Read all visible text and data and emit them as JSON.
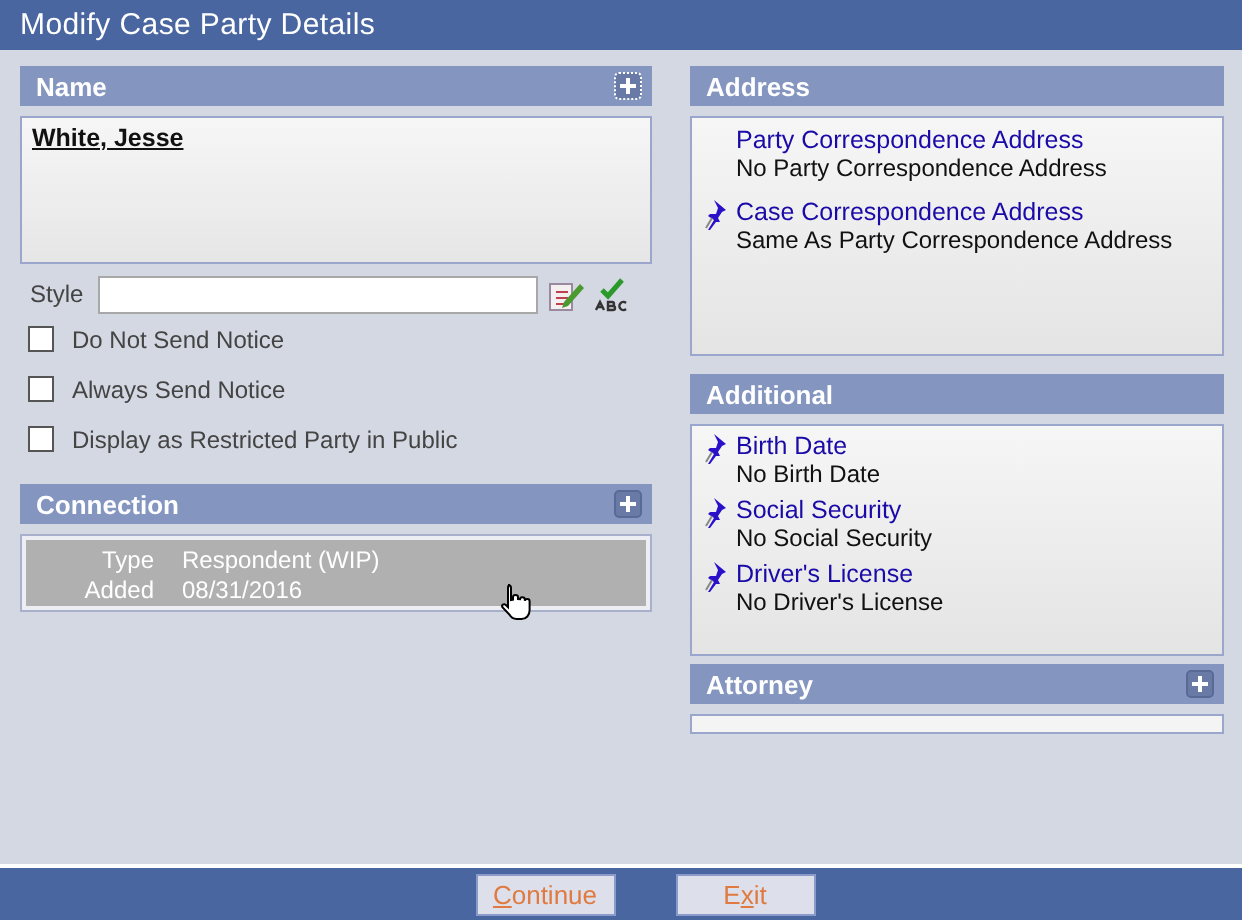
{
  "window": {
    "title": "Modify Case Party Details"
  },
  "name_section": {
    "title": "Name",
    "party_name": "White, Jesse",
    "style_label": "Style",
    "checkboxes": [
      {
        "label": "Do Not Send Notice",
        "checked": false
      },
      {
        "label": "Always Send Notice",
        "checked": false
      },
      {
        "label": "Display as Restricted Party in Public",
        "checked": false
      }
    ]
  },
  "connection": {
    "title": "Connection",
    "rows": [
      {
        "selected": true,
        "fields": [
          {
            "label": "Type",
            "value": "Respondent (WIP)"
          },
          {
            "label": "Added",
            "value": "08/31/2016"
          }
        ]
      }
    ]
  },
  "address": {
    "title": "Address",
    "items": [
      {
        "title": "Party Correspondence Address",
        "value": "No Party Correspondence Address",
        "pinned": false
      },
      {
        "title": "Case Correspondence Address",
        "value": "Same As Party Correspondence Address",
        "pinned": true
      }
    ]
  },
  "additional": {
    "title": "Additional",
    "items": [
      {
        "title": "Birth Date",
        "value": "No Birth Date",
        "pinned": true
      },
      {
        "title": "Social Security",
        "value": "No Social Security",
        "pinned": true
      },
      {
        "title": "Driver's License",
        "value": "No Driver's License",
        "pinned": true
      }
    ]
  },
  "attorney": {
    "title": "Attorney"
  },
  "buttons": [
    {
      "access_key": "C",
      "label_after": "ontinue"
    },
    {
      "label_before": "E",
      "access_key": "x",
      "label_after": "it"
    }
  ]
}
